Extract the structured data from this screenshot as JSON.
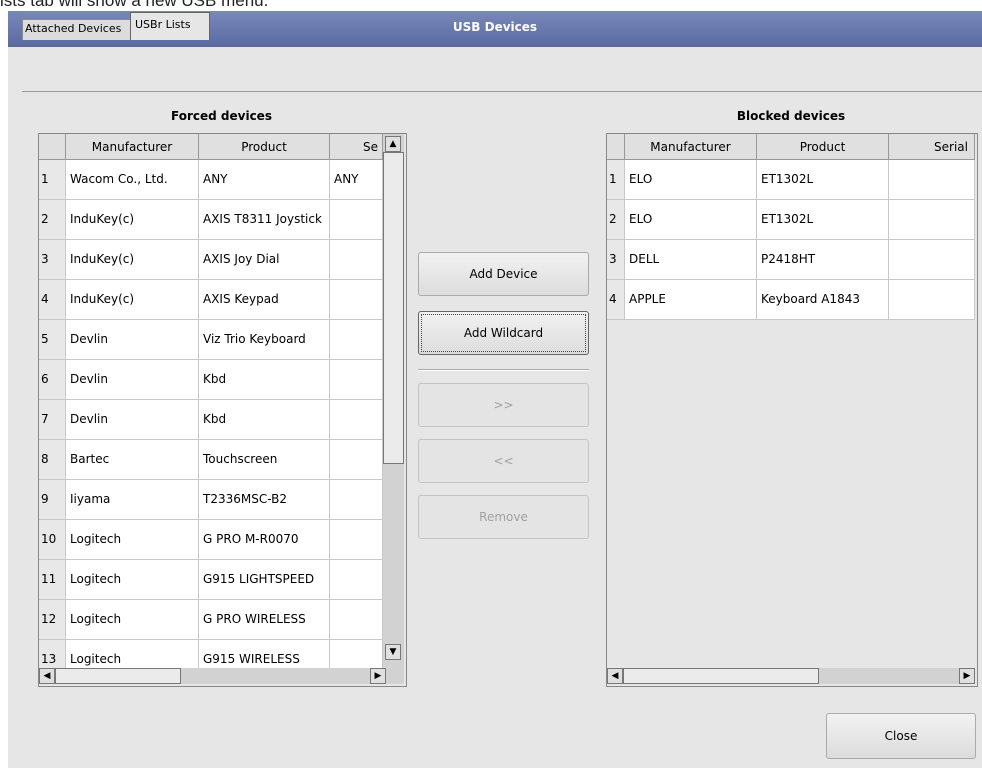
{
  "caption": "ists tab will show a new USB menu.",
  "window": {
    "title": "USB Devices"
  },
  "tabs": [
    {
      "label": "Attached Devices"
    },
    {
      "label": "USBr Lists"
    }
  ],
  "forced": {
    "title": "Forced devices",
    "columns": [
      "Manufacturer",
      "Product",
      "Se"
    ],
    "rows": [
      {
        "num": "1",
        "manufacturer": "Wacom Co., Ltd.",
        "product": "ANY",
        "serial": "ANY"
      },
      {
        "num": "2",
        "manufacturer": "InduKey(c)",
        "product": "AXIS T8311 Joystick",
        "serial": ""
      },
      {
        "num": "3",
        "manufacturer": "InduKey(c)",
        "product": "AXIS Joy Dial",
        "serial": ""
      },
      {
        "num": "4",
        "manufacturer": "InduKey(c)",
        "product": "AXIS Keypad",
        "serial": ""
      },
      {
        "num": "5",
        "manufacturer": "Devlin",
        "product": "Viz Trio Keyboard",
        "serial": ""
      },
      {
        "num": "6",
        "manufacturer": "Devlin",
        "product": "Kbd",
        "serial": ""
      },
      {
        "num": "7",
        "manufacturer": "Devlin",
        "product": "Kbd",
        "serial": ""
      },
      {
        "num": "8",
        "manufacturer": "Bartec",
        "product": "Touchscreen",
        "serial": ""
      },
      {
        "num": "9",
        "manufacturer": "Iiyama",
        "product": "T2336MSC-B2",
        "serial": ""
      },
      {
        "num": "10",
        "manufacturer": "Logitech",
        "product": "G PRO M-R0070",
        "serial": ""
      },
      {
        "num": "11",
        "manufacturer": "Logitech",
        "product": "G915 LIGHTSPEED",
        "serial": ""
      },
      {
        "num": "12",
        "manufacturer": "Logitech",
        "product": "G PRO WIRELESS",
        "serial": ""
      },
      {
        "num": "13",
        "manufacturer": "Logitech",
        "product": "G915 WIRELESS",
        "serial": ""
      }
    ]
  },
  "blocked": {
    "title": "Blocked devices",
    "columns": [
      "Manufacturer",
      "Product",
      "Serial"
    ],
    "rows": [
      {
        "num": "1",
        "manufacturer": "ELO",
        "product": "ET1302L",
        "serial": ""
      },
      {
        "num": "2",
        "manufacturer": "ELO",
        "product": "ET1302L",
        "serial": ""
      },
      {
        "num": "3",
        "manufacturer": "DELL",
        "product": "P2418HT",
        "serial": ""
      },
      {
        "num": "4",
        "manufacturer": "APPLE",
        "product": "Keyboard A1843",
        "serial": ""
      }
    ]
  },
  "buttons": {
    "add_device": "Add Device",
    "add_wildcard": "Add Wildcard",
    "move_right": ">>",
    "move_left": "<<",
    "remove": "Remove",
    "close": "Close"
  },
  "icons": {
    "scroll_up": "arrow-up-icon",
    "scroll_down": "arrow-down-icon",
    "scroll_left": "arrow-left-icon",
    "scroll_right": "arrow-right-icon"
  },
  "colors": {
    "titlebar": "#6675ab",
    "window_bg": "#e6e6e6"
  }
}
